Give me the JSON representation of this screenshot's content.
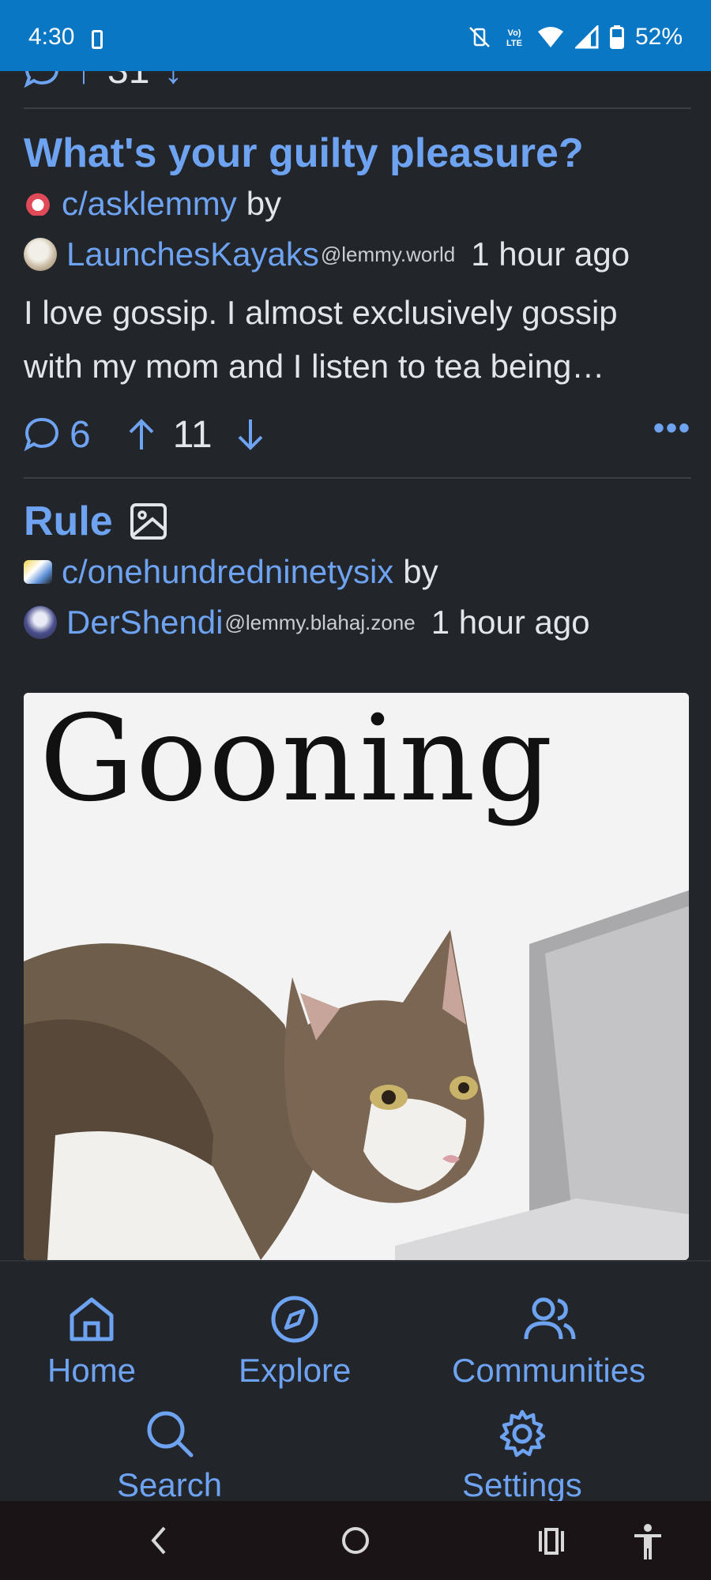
{
  "status_bar": {
    "time": "4:30",
    "battery": "52%",
    "network": "LTE"
  },
  "previous_post": {
    "score": "31"
  },
  "posts": [
    {
      "title": "What's your guilty pleasure?",
      "community": "c/asklemmy",
      "by": "by",
      "author": "LaunchesKayaks",
      "instance": "@lemmy.world",
      "time": "1 hour ago",
      "body_line1": "I love gossip. I almost exclusively gossip",
      "body_line2": "with my mom and I listen to tea being…",
      "comments": "6",
      "score": "11"
    },
    {
      "title": "Rule",
      "community": "c/onehundredninetysix",
      "by": "by",
      "author": "DerShendi",
      "instance": "@lemmy.blahaj.zone",
      "time": "1 hour ago",
      "image_text": "Gooning"
    }
  ],
  "bottom_nav": {
    "home": "Home",
    "explore": "Explore",
    "communities": "Communities",
    "search": "Search",
    "settings": "Settings"
  },
  "colors": {
    "accent": "#6ea3f2",
    "background": "#222529",
    "status_bar": "#0a77c4"
  }
}
